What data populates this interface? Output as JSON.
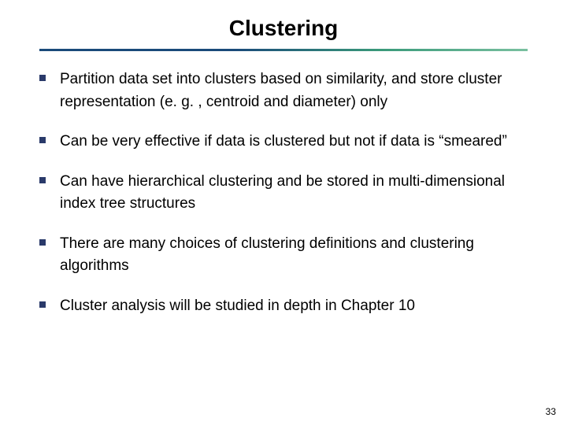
{
  "title": "Clustering",
  "bullets": {
    "b0": "Partition data set into clusters based on similarity, and store cluster representation (e. g. , centroid and diameter) only",
    "b1": "Can be very effective if data is clustered but not if data is “smeared”",
    "b2": "Can have hierarchical clustering and be stored in multi-dimensional index tree structures",
    "b3": "There are many choices of clustering definitions and clustering algorithms",
    "b4": "Cluster analysis will be studied in depth in Chapter 10"
  },
  "page_number": "33"
}
